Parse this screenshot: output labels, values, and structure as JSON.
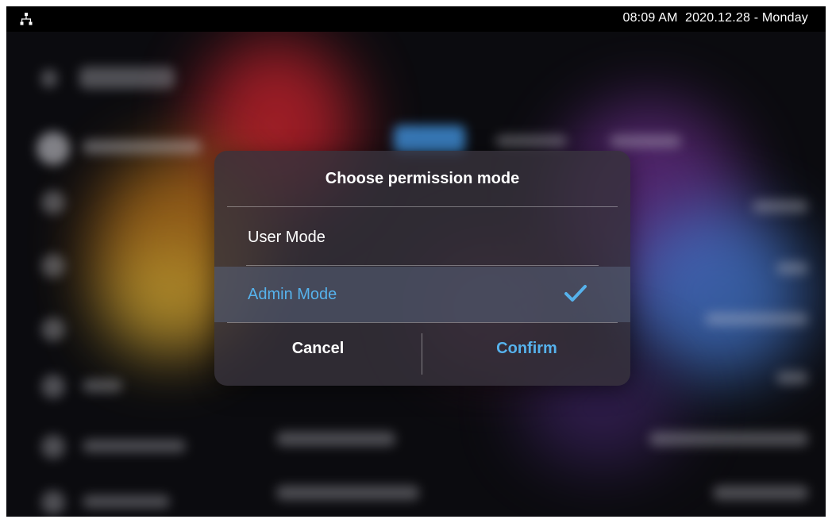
{
  "status_bar": {
    "time_date": "08:09 AM  2020.12.28 - Monday",
    "network_icon": "network-icon"
  },
  "dialog": {
    "title": "Choose permission mode",
    "options": [
      {
        "label": "User Mode",
        "selected": false
      },
      {
        "label": "Admin Mode",
        "selected": true
      }
    ],
    "selected_icon": "check-icon",
    "cancel_label": "Cancel",
    "confirm_label": "Confirm"
  },
  "colors": {
    "accent": "#56b2ec",
    "statusbar_bg": "#000000",
    "screen_bg": "#0b0b0f"
  }
}
